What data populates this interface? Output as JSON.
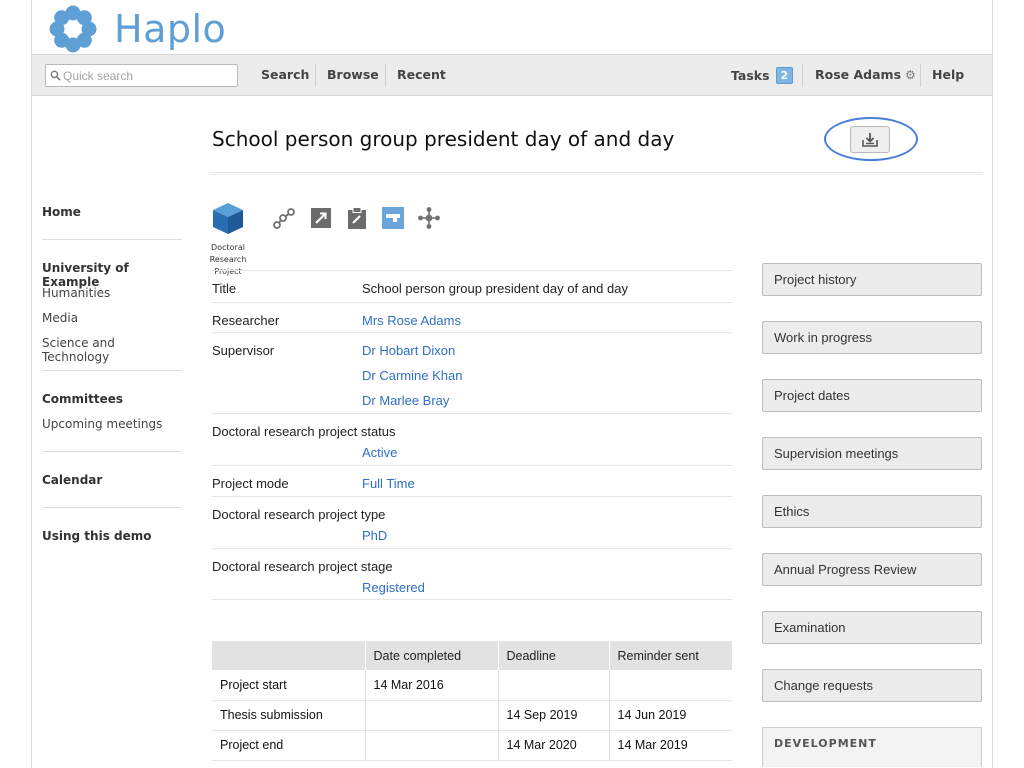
{
  "brand": {
    "name": "Haplo",
    "logo_color": "#5e9fd6"
  },
  "navbar": {
    "search_placeholder": "Quick search",
    "links": {
      "search": "Search",
      "browse": "Browse",
      "recent": "Recent"
    },
    "tasks": {
      "label": "Tasks",
      "count": "2"
    },
    "user": "Rose Adams",
    "help": "Help"
  },
  "sidebar": {
    "home": "Home",
    "university": "University of Example",
    "faculties": [
      "Humanities",
      "Media",
      "Science and Technology"
    ],
    "committees": "Committees",
    "upcoming": "Upcoming meetings",
    "calendar": "Calendar",
    "demo": "Using this demo"
  },
  "page": {
    "title": "School person group president day of and day",
    "type_label": [
      "Doctoral",
      "Research",
      "Project"
    ]
  },
  "icons": [
    "doctoral-research-project-icon",
    "workflow-icon",
    "edit-arrow-icon",
    "clipboard-icon",
    "card-icon",
    "network-icon",
    "export-icon",
    "search-icon",
    "gear-icon"
  ],
  "fields": {
    "title_label": "Title",
    "title_value": "School person group president day of and day",
    "researcher_label": "Researcher",
    "researcher_value": "Mrs Rose Adams",
    "supervisor_label": "Supervisor",
    "supervisors": [
      "Dr Hobart Dixon",
      "Dr Carmine Khan",
      "Dr Marlee Bray"
    ],
    "status_label": "Doctoral research project status",
    "status_value": "Active",
    "mode_label": "Project mode",
    "mode_value": "Full Time",
    "type_label": "Doctoral research project type",
    "type_value": "PhD",
    "stage_label": "Doctoral research project stage",
    "stage_value": "Registered"
  },
  "dates_table": {
    "headers": [
      "",
      "Date completed",
      "Deadline",
      "Reminder sent"
    ],
    "rows": [
      [
        "Project start",
        "14 Mar 2016",
        "",
        ""
      ],
      [
        "Thesis submission",
        "",
        "14 Sep 2019",
        "14 Jun 2019"
      ],
      [
        "Project end",
        "",
        "14 Mar 2020",
        "14 Mar 2019"
      ]
    ]
  },
  "actions": [
    "Project history",
    "Work in progress",
    "Project dates",
    "Supervision meetings",
    "Ethics",
    "Annual Progress Review",
    "Examination",
    "Change requests"
  ],
  "development_heading": "DEVELOPMENT",
  "colors": {
    "link": "#2f6fc6",
    "accent": "#5e9fd6",
    "highlight": "#4a7fd8"
  }
}
